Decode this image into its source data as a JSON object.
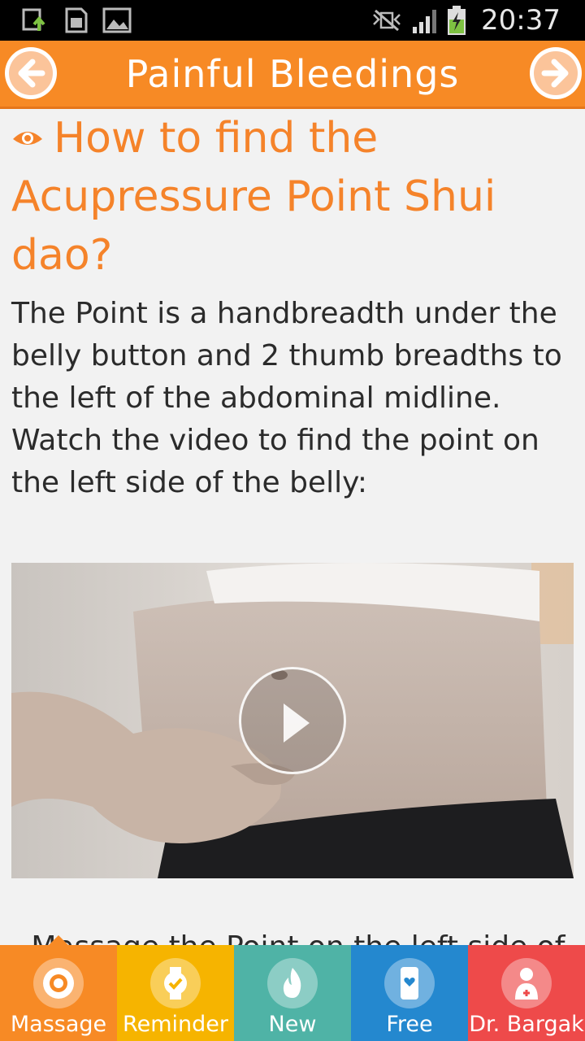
{
  "status_bar": {
    "time": "20:37",
    "icons": [
      "image-upload-icon",
      "sd-card-icon",
      "gallery-icon",
      "mute-vibrate-icon",
      "signal-icon",
      "battery-charging-icon"
    ]
  },
  "header": {
    "title": "Painful Bleedings",
    "prev_icon": "arrow-left-icon",
    "next_icon": "arrow-right-icon"
  },
  "content": {
    "heading_icon": "eye-icon",
    "heading": "How to find the Acupressure Point Shui dao?",
    "body": "The Point is a handbreadth under the belly button and 2 thumb breadths to the left of the abdominal midline. Watch the video to find the point on the left side of the belly:",
    "video_icon": "play-icon",
    "partial_text": "- Massage the Point on the left side of"
  },
  "colors": {
    "accent": "#f78a25",
    "heading": "#f5832a"
  },
  "tabs": [
    {
      "label": "Massage",
      "icon": "target-icon",
      "color": "#f78a25",
      "active": true
    },
    {
      "label": "Reminder",
      "icon": "watch-check-icon",
      "color": "#f6b400",
      "active": false
    },
    {
      "label": "New",
      "icon": "flame-icon",
      "color": "#4fb3a6",
      "active": false
    },
    {
      "label": "Free",
      "icon": "phone-heart-icon",
      "color": "#2488cf",
      "active": false
    },
    {
      "label": "Dr. Bargak",
      "icon": "doctor-icon",
      "color": "#ee4a4a",
      "active": false
    }
  ]
}
